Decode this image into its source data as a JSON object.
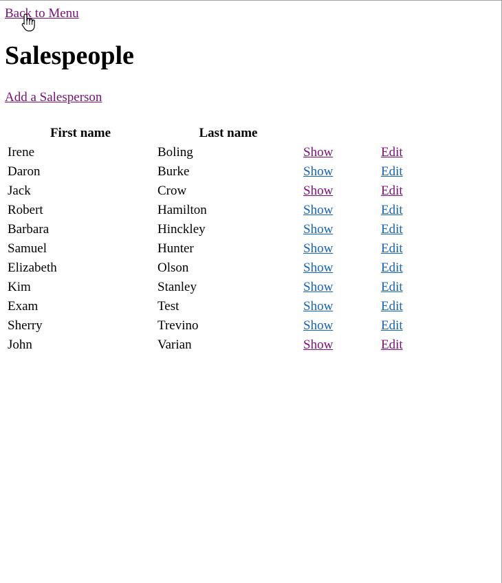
{
  "nav": {
    "back_label": "Back to Menu",
    "add_label": "Add a Salesperson"
  },
  "page": {
    "title": "Salespeople"
  },
  "table": {
    "headers": {
      "first_name": "First name",
      "last_name": "Last name",
      "show": "",
      "edit": ""
    },
    "rows": [
      {
        "first": "Irene",
        "last": "Boling",
        "show": "Show",
        "edit": "Edit",
        "show_visited": true,
        "edit_visited": true
      },
      {
        "first": "Daron",
        "last": "Burke",
        "show": "Show",
        "edit": "Edit",
        "show_visited": false,
        "edit_visited": false
      },
      {
        "first": "Jack",
        "last": "Crow",
        "show": "Show",
        "edit": "Edit",
        "show_visited": true,
        "edit_visited": true
      },
      {
        "first": "Robert",
        "last": "Hamilton",
        "show": "Show",
        "edit": "Edit",
        "show_visited": false,
        "edit_visited": false
      },
      {
        "first": "Barbara",
        "last": "Hinckley",
        "show": "Show",
        "edit": "Edit",
        "show_visited": false,
        "edit_visited": false
      },
      {
        "first": "Samuel",
        "last": "Hunter",
        "show": "Show",
        "edit": "Edit",
        "show_visited": false,
        "edit_visited": false
      },
      {
        "first": "Elizabeth",
        "last": "Olson",
        "show": "Show",
        "edit": "Edit",
        "show_visited": false,
        "edit_visited": false
      },
      {
        "first": "Kim",
        "last": "Stanley",
        "show": "Show",
        "edit": "Edit",
        "show_visited": false,
        "edit_visited": false
      },
      {
        "first": "Exam",
        "last": "Test",
        "show": "Show",
        "edit": "Edit",
        "show_visited": false,
        "edit_visited": false
      },
      {
        "first": "Sherry",
        "last": "Trevino",
        "show": "Show",
        "edit": "Edit",
        "show_visited": false,
        "edit_visited": false
      },
      {
        "first": "John",
        "last": "Varian",
        "show": "Show",
        "edit": "Edit",
        "show_visited": true,
        "edit_visited": true
      }
    ]
  },
  "colors": {
    "visited_link": "#7a0f7a",
    "unvisited_link": "#1464b4"
  },
  "cursor": {
    "icon": "hand-pointer-icon"
  }
}
